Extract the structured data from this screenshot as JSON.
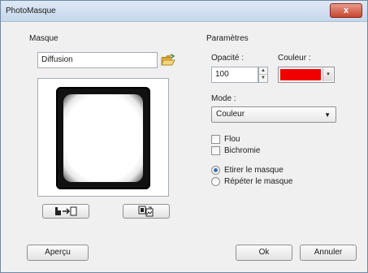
{
  "window": {
    "title": "PhotoMasque",
    "close_glyph": "x"
  },
  "masque": {
    "section_label": "Masque",
    "name_value": "Diffusion",
    "open_icon": "folder-open-icon",
    "preview_icon": "mask-preview",
    "btn_left_icon": "copy-to-icon",
    "btn_right_icon": "image-swap-icon"
  },
  "parametres": {
    "section_label": "Paramètres",
    "opacite_label": "Opacité :",
    "opacite_value": "100",
    "couleur_label": "Couleur :",
    "couleur_value": "#f00000",
    "mode_label": "Mode :",
    "mode_value": "Couleur",
    "flou_label": "Flou",
    "flou_checked": false,
    "bichromie_label": "Bichromie",
    "bichromie_checked": false,
    "radio_etirer_label": "Etirer le masque",
    "radio_repeter_label": "Répéter le masque",
    "selected_radio": "etirer"
  },
  "footer": {
    "apercu_label": "Aperçu",
    "ok_label": "Ok",
    "annuler_label": "Annuler"
  }
}
